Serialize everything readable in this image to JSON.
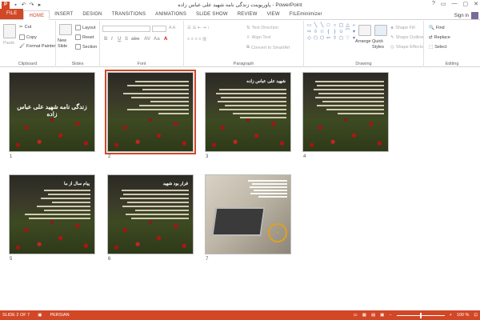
{
  "window": {
    "title": "پاورپوینت زندگی نامه شهید علی عباس زاده - PowerPoint",
    "controls": [
      "?",
      "▭",
      "—",
      "▢",
      "✕"
    ]
  },
  "tabs": [
    "FILE",
    "HOME",
    "INSERT",
    "DESIGN",
    "TRANSITIONS",
    "ANIMATIONS",
    "SLIDE SHOW",
    "REVIEW",
    "VIEW",
    "FILEminimizer"
  ],
  "active_tab": "HOME",
  "account": {
    "signin": "Sign in"
  },
  "ribbon": {
    "clipboard": {
      "label": "Clipboard",
      "paste": "Paste",
      "cut": "Cut",
      "copy": "Copy",
      "format_painter": "Format Painter"
    },
    "slides": {
      "label": "Slides",
      "new_slide": "New Slide",
      "layout": "Layout",
      "reset": "Reset",
      "section": "Section"
    },
    "font": {
      "label": "Font",
      "buttons": [
        "B",
        "I",
        "U",
        "S",
        "abc",
        "AV",
        "Aa",
        "A"
      ]
    },
    "paragraph": {
      "label": "Paragraph",
      "text_direction": "Text Direction",
      "align_text": "Align Text",
      "smartart": "Convert to SmartArt"
    },
    "drawing": {
      "label": "Drawing",
      "arrange": "Arrange",
      "quick_styles": "Quick Styles",
      "shape_fill": "Shape Fill",
      "shape_outline": "Shape Outline",
      "shape_effects": "Shape Effects"
    },
    "editing": {
      "label": "Editing",
      "find": "Find",
      "replace": "Replace",
      "select": "Select"
    }
  },
  "slides": [
    {
      "number": "1",
      "title": "زندگی نامه شهید علی عباس زاده",
      "selected": false
    },
    {
      "number": "2",
      "heading": "",
      "selected": true
    },
    {
      "number": "3",
      "heading": "شهید علی عباس زاده",
      "selected": false
    },
    {
      "number": "4",
      "heading": "",
      "selected": false
    },
    {
      "number": "5",
      "heading": "پیام سال از ما",
      "selected": false
    },
    {
      "number": "6",
      "heading": "قرار بود شهید",
      "selected": false
    },
    {
      "number": "7",
      "heading": "",
      "selected": false
    }
  ],
  "status": {
    "slide_info": "SLIDE 2 OF 7",
    "language": "PERSIAN",
    "zoom": "100 %",
    "zoom_value": 0.5
  }
}
